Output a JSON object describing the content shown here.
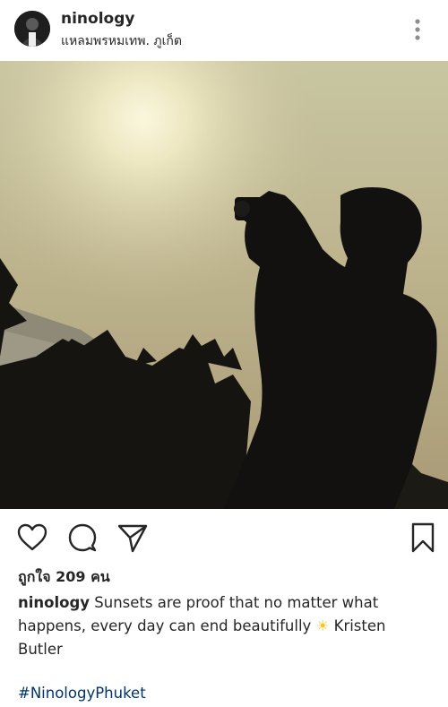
{
  "post": {
    "username": "ninology",
    "location": "แหลมพรหมเทพ. ภูเก็ต",
    "likes": "ถูกใจ 209 คน",
    "caption_user": "ninology",
    "caption_text": " Sunsets are proof that no matter what happens, every day can end beautifully ",
    "caption_emoji": "☀",
    "caption_tail": " Kristen Butler",
    "hashtag": "#NinologyPhuket"
  },
  "icons": {
    "more": "more-vertical-icon",
    "like": "heart-icon",
    "comment": "comment-bubble-icon",
    "share": "paper-plane-icon",
    "save": "bookmark-icon"
  },
  "colors": {
    "text": "#262626",
    "hashtag": "#003569",
    "emoji": "#f5c518"
  }
}
